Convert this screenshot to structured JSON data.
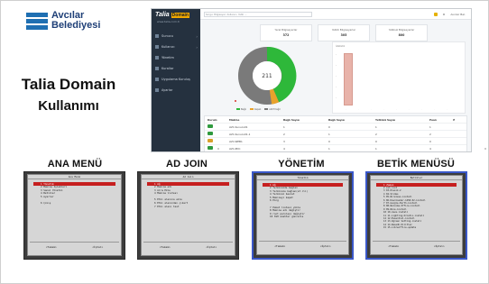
{
  "logo": {
    "line1": "Avcılar",
    "line2": "Belediyesi",
    "brand_color": "#1f6fb2"
  },
  "title": {
    "line1": "Talia Domain",
    "line2": "Kullanımı"
  },
  "dashboard": {
    "brand": "Talia",
    "brand_tag": "Domain",
    "brand_sub": "www.talia.com.tr",
    "search_placeholder": "Sorgu: Bilgisayar, Kullanıcı, Yetki ...",
    "top_user": "Avcılar Bel.",
    "nav": [
      "Sunucu",
      "Kullanıcı",
      "Yönetim",
      "Kurallar",
      "Uygulama Kuruluş",
      "Ayarlar"
    ],
    "cards": [
      {
        "label": "Yerel Bilgisayarlar",
        "value": "372"
      },
      {
        "label": "Yetkili Bilgisayarlar",
        "value": "305"
      },
      {
        "label": "Yetkisiz Bilgisayarlar",
        "value": "800"
      }
    ],
    "donut": {
      "center": "211",
      "legend": [
        "Bağlı",
        "Kapalı",
        "Aktif Değil"
      ],
      "colors": [
        "#2eb83a",
        "#e8a22c",
        "#7a7a7a"
      ]
    },
    "bar_panel_title": "İstatistik",
    "table": {
      "headers": [
        "Durum",
        "Makine",
        "Bağlı Sayısı",
        "Bağlı Sayısı",
        "Yetkisiz Sayısı",
        "Puan",
        ""
      ],
      "rows": [
        [
          "",
          "AVC-Sunucu01",
          "1",
          "0",
          "1",
          "1"
        ],
        [
          "",
          "AVC-Sunucu01-1",
          "2",
          "1",
          "2",
          "2"
        ],
        [
          "",
          "AVC-WEB1",
          "3",
          "0",
          "0",
          "0"
        ],
        [
          "",
          "AVC-PDC",
          "4",
          "1",
          "1",
          "4"
        ]
      ]
    }
  },
  "sections": [
    {
      "heading": "ANA MENÜ",
      "title": "Ana Menü",
      "selected": "1 Yönetim",
      "items": [
        "2 Makine İşlemleri",
        "3 Sanal Yönetim",
        "4 Betikler",
        "5 Ayarlar",
        "",
        "6 Çıkış"
      ],
      "buttons": [
        "<Tamam>",
        "<İptal>"
      ]
    },
    {
      "heading": "AD JOIN",
      "title": "Ad Join",
      "selected": "1 Ağ",
      "items": [
        "2 Makine adı",
        "3 Ad & Ekle",
        "4 Makine listesi",
        "",
        "5 Etki alanına ekle",
        "6 Etki alanından çıkart",
        "7 Etki alanı test"
      ],
      "buttons": [
        "<Tamam>",
        "<İptal>"
      ]
    },
    {
      "heading": "YÖNETİM",
      "title": "Yönetim",
      "selected": "1 Ağ",
      "items": [
        "2 Terminalde bağlan",
        "3 Terminale bağlan(s3 cli)",
        "4 Terminal baslat",
        "5 Makineyi kapat",
        "6 Ping",
        "",
        "7 Paket listesi yükle",
        "8 Makine adı değiştir",
        "9 root parolası değiştir",
        "10 SSH anahtar güncelle"
      ],
      "buttons": [
        "<Tamam>",
        "<İptal>"
      ]
    },
    {
      "heading": "BETİK MENÜSÜ",
      "title": "Betikler",
      "selected": "1 Zaman",
      "items": [
        "2 ssh-root",
        "3 03-Klasik-2",
        "4 04-Slides",
        "5 05-Wireless-install",
        "6 06-Downloader-1458-02-install",
        "7 07-Google-Earth-install",
        "8 08-Welcome-Office-install",
        "9 09-Wine-install",
        "10 10-Java-install",
        "11 11-Lighting-Ornatix-install",
        "12 12-Essential-install",
        "13 13-Ogreen Setting-install",
        "14 14-Rasedh-Kilitlez",
        "15 15-Libreoffice-update"
      ],
      "buttons": [
        "<Tamam>",
        "<İptal>"
      ]
    }
  ]
}
